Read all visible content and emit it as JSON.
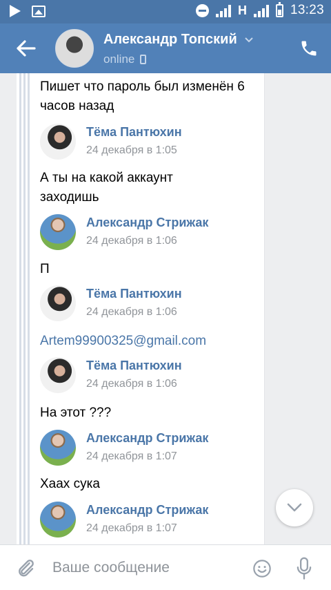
{
  "status_bar": {
    "time": "13:23",
    "network": "H"
  },
  "header": {
    "name": "Александр Топский",
    "status": "online"
  },
  "messages": [
    {
      "type": "text",
      "text": "Пишет что пароль был изменён 6 часов назад"
    },
    {
      "type": "author",
      "name": "Тёма Пантюхин",
      "time": "24 декабря в 1:05"
    },
    {
      "type": "text",
      "text": "А ты на какой аккаунт заходишь"
    },
    {
      "type": "author",
      "name": "Александр Стрижак",
      "time": "24 декабря в 1:06"
    },
    {
      "type": "text",
      "text": "П"
    },
    {
      "type": "author",
      "name": "Тёма Пантюхин",
      "time": "24 декабря в 1:06"
    },
    {
      "type": "link",
      "text": "Artem99900325@gmail.com"
    },
    {
      "type": "author",
      "name": "Тёма Пантюхин",
      "time": "24 декабря в 1:06"
    },
    {
      "type": "text",
      "text": "На этот ???"
    },
    {
      "type": "author",
      "name": "Александр Стрижак",
      "time": "24 декабря в 1:07"
    },
    {
      "type": "text",
      "text": "Хаах сука"
    },
    {
      "type": "author",
      "name": "Александр Стрижак",
      "time": "24 декабря в 1:07"
    }
  ],
  "input": {
    "placeholder": "Ваше сообщение"
  },
  "colors": {
    "header": "#5181b8",
    "statusbar": "#4a76a8",
    "link": "#4a76a8"
  }
}
